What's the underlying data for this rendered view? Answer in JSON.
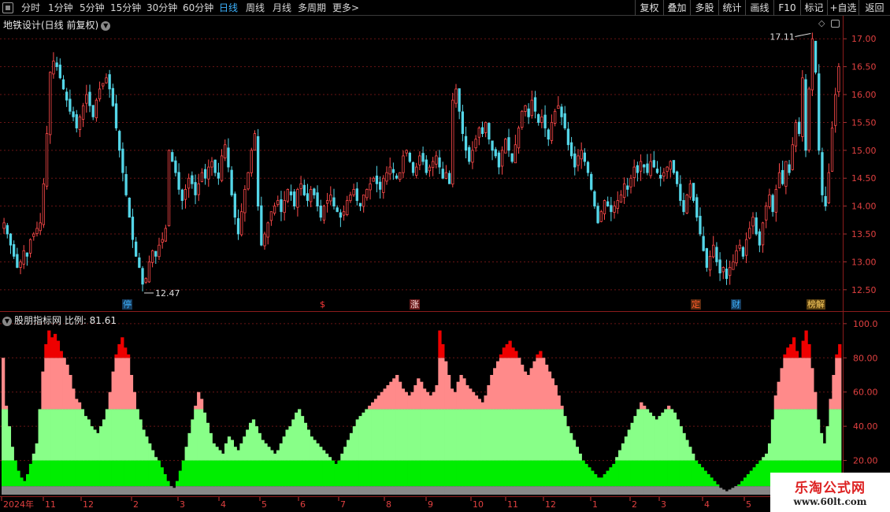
{
  "toolbar": {
    "periods": [
      "分时",
      "1分钟",
      "5分钟",
      "15分钟",
      "30分钟",
      "60分钟",
      "日线",
      "周线",
      "月线",
      "多周期",
      "更多>"
    ],
    "active_period": "日线",
    "right_buttons": [
      "复权",
      "叠加",
      "多股",
      "统计",
      "画线",
      "F10",
      "标记",
      "+自选",
      "返回"
    ]
  },
  "main_panel": {
    "title": "地铁设计(日线 前复权)",
    "high_label": "17.11",
    "low_label": "12.47",
    "markers": [
      {
        "text": "停",
        "color": "#3db3ff",
        "bg": "#163a5a"
      },
      {
        "text": "$",
        "color": "#ff3b3b",
        "bg": ""
      },
      {
        "text": "涨",
        "color": "#ffdddd",
        "bg": "#6a1a1a"
      },
      {
        "text": "定",
        "color": "#ff5b2a",
        "bg": "#5a2a10"
      },
      {
        "text": "财",
        "color": "#3db3ff",
        "bg": "#163a5a"
      },
      {
        "text": "榜解",
        "color": "#ffd060",
        "bg": "#5a4010"
      }
    ]
  },
  "indicator_panel": {
    "title": "股朋指标网 比例: 81.61"
  },
  "chart_data": [
    {
      "type": "candlestick",
      "title": "地铁设计(日线 前复权)",
      "ylim": [
        12.3,
        17.3
      ],
      "y_ticks": [
        "17.00",
        "16.50",
        "16.00",
        "15.50",
        "15.00",
        "14.50",
        "14.00",
        "13.50",
        "13.00",
        "12.50"
      ],
      "max_annotation": 17.11,
      "min_annotation": 12.47,
      "close_series": [
        13.7,
        13.5,
        13.3,
        13.1,
        12.9,
        13.0,
        13.2,
        13.1,
        13.4,
        13.5,
        13.6,
        13.7,
        14.4,
        15.3,
        16.4,
        16.6,
        16.5,
        16.3,
        16.1,
        15.9,
        15.7,
        15.6,
        15.4,
        15.6,
        15.8,
        16.0,
        15.8,
        15.6,
        15.9,
        16.1,
        16.2,
        16.3,
        16.1,
        15.8,
        15.4,
        15.0,
        14.6,
        14.2,
        13.8,
        13.4,
        13.1,
        12.9,
        12.6,
        12.7,
        13.0,
        13.2,
        13.1,
        13.3,
        13.4,
        13.6,
        15.0,
        14.8,
        14.6,
        14.3,
        14.1,
        14.3,
        14.5,
        14.4,
        14.2,
        14.4,
        14.6,
        14.5,
        14.7,
        14.8,
        14.6,
        14.5,
        14.9,
        15.1,
        14.7,
        14.2,
        13.8,
        13.5,
        13.9,
        14.3,
        14.6,
        15.0,
        15.3,
        14.0,
        13.3,
        13.5,
        13.7,
        13.9,
        14.0,
        14.1,
        13.9,
        14.1,
        14.3,
        14.2,
        14.0,
        14.3,
        14.4,
        14.2,
        14.1,
        14.3,
        14.2,
        14.0,
        13.8,
        14.0,
        14.1,
        14.2,
        14.0,
        13.9,
        13.8,
        13.9,
        14.1,
        14.2,
        14.3,
        14.1,
        14.0,
        14.2,
        14.3,
        14.4,
        14.5,
        14.4,
        14.3,
        14.5,
        14.6,
        14.7,
        14.6,
        14.5,
        14.6,
        14.9,
        15.0,
        14.8,
        14.6,
        14.7,
        14.9,
        14.8,
        14.6,
        14.7,
        14.8,
        14.9,
        14.7,
        14.5,
        14.6,
        14.4,
        15.9,
        16.1,
        15.7,
        15.3,
        15.0,
        14.8,
        15.0,
        15.2,
        15.4,
        15.3,
        15.5,
        15.2,
        15.0,
        14.9,
        14.7,
        15.0,
        15.2,
        15.0,
        14.8,
        15.1,
        15.4,
        15.7,
        15.8,
        15.6,
        15.9,
        15.7,
        15.5,
        15.6,
        15.4,
        15.2,
        15.5,
        15.7,
        15.8,
        15.6,
        15.4,
        15.1,
        14.9,
        14.7,
        14.9,
        15.0,
        14.8,
        14.6,
        14.3,
        14.0,
        13.7,
        13.9,
        14.1,
        14.0,
        13.9,
        14.0,
        14.1,
        14.2,
        14.4,
        14.3,
        14.5,
        14.7,
        14.6,
        14.8,
        14.7,
        14.6,
        14.8,
        14.7,
        14.6,
        14.5,
        14.6,
        14.7,
        14.8,
        14.6,
        14.4,
        14.1,
        13.9,
        14.2,
        14.4,
        14.1,
        13.8,
        13.5,
        13.2,
        12.9,
        13.1,
        13.3,
        13.0,
        12.8,
        12.9,
        12.7,
        12.9,
        13.0,
        13.2,
        13.3,
        13.1,
        13.4,
        13.6,
        13.8,
        13.5,
        13.3,
        13.7,
        14.0,
        14.2,
        13.9,
        14.3,
        14.6,
        14.4,
        14.8,
        14.6,
        15.1,
        15.5,
        15.3,
        16.3,
        15.0,
        16.1,
        17.0,
        16.4,
        15.0,
        14.2,
        14.0,
        14.6,
        15.4,
        16.0,
        16.5
      ]
    },
    {
      "type": "area",
      "title": "股朋指标网 比例: 81.61",
      "ylim": [
        0,
        105
      ],
      "y_ticks": [
        "100.0",
        "80.00",
        "60.00",
        "40.00",
        "20.00"
      ],
      "last_value": 81.61,
      "bands": [
        {
          "from": 0,
          "to": 5,
          "color": "#888888"
        },
        {
          "from": 5,
          "to": 20,
          "color": "#00ee00"
        },
        {
          "from": 20,
          "to": 50,
          "color": "#88ff88"
        },
        {
          "from": 50,
          "to": 80,
          "color": "#ff8a8a"
        },
        {
          "from": 80,
          "to": 110,
          "color": "#ee0000"
        }
      ],
      "values": [
        80,
        52,
        40,
        28,
        20,
        14,
        10,
        8,
        12,
        18,
        24,
        30,
        50,
        72,
        88,
        96,
        92,
        94,
        90,
        84,
        80,
        76,
        70,
        62,
        56,
        54,
        50,
        46,
        44,
        40,
        38,
        36,
        40,
        44,
        50,
        60,
        72,
        82,
        88,
        92,
        86,
        82,
        70,
        60,
        50,
        44,
        38,
        34,
        30,
        26,
        22,
        20,
        16,
        12,
        8,
        5,
        4,
        8,
        14,
        20,
        28,
        36,
        44,
        52,
        60,
        56,
        48,
        42,
        36,
        30,
        28,
        26,
        24,
        30,
        34,
        32,
        28,
        26,
        30,
        34,
        38,
        42,
        44,
        40,
        36,
        32,
        30,
        28,
        26,
        24,
        26,
        30,
        34,
        38,
        40,
        44,
        48,
        50,
        46,
        42,
        38,
        34,
        32,
        30,
        28,
        26,
        24,
        22,
        20,
        18,
        20,
        24,
        28,
        32,
        36,
        40,
        44,
        46,
        48,
        50,
        52,
        54,
        56,
        58,
        60,
        62,
        64,
        66,
        68,
        70,
        66,
        62,
        60,
        58,
        60,
        64,
        68,
        66,
        62,
        60,
        58,
        60,
        64,
        96,
        88,
        78,
        70,
        62,
        60,
        66,
        70,
        68,
        64,
        62,
        60,
        58,
        56,
        54,
        58,
        64,
        70,
        74,
        78,
        82,
        86,
        88,
        90,
        86,
        84,
        80,
        76,
        72,
        70,
        74,
        78,
        82,
        84,
        80,
        76,
        72,
        68,
        64,
        58,
        52,
        46,
        40,
        36,
        32,
        28,
        24,
        20,
        18,
        16,
        14,
        12,
        10,
        10,
        12,
        14,
        16,
        18,
        22,
        26,
        30,
        34,
        38,
        42,
        46,
        50,
        54,
        52,
        50,
        48,
        46,
        44,
        46,
        48,
        50,
        52,
        50,
        48,
        44,
        40,
        36,
        32,
        28,
        24,
        20,
        18,
        16,
        14,
        12,
        10,
        8,
        6,
        4,
        3,
        2,
        3,
        4,
        5,
        6,
        8,
        10,
        12,
        14,
        16,
        18,
        20,
        22,
        24,
        30,
        44,
        58,
        66,
        74,
        82,
        86,
        88,
        92,
        84,
        80,
        90,
        96,
        88,
        74,
        60,
        44,
        36,
        30,
        40,
        56,
        70,
        82,
        88
      ]
    }
  ]
}
